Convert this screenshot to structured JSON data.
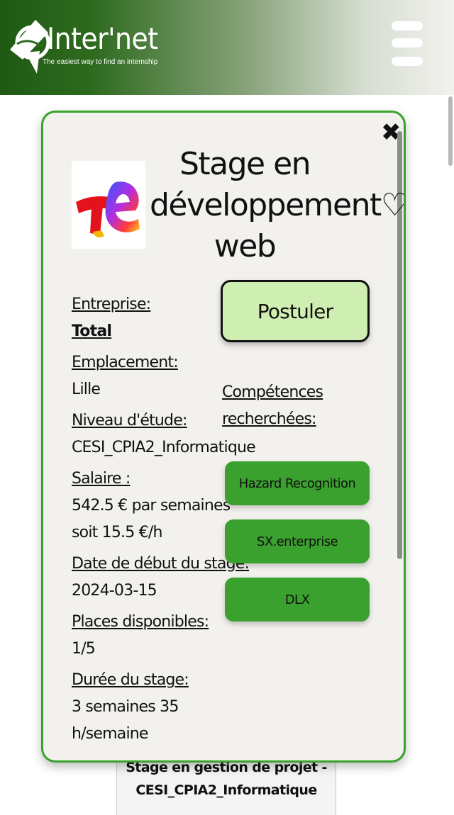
{
  "header": {
    "brand": "Inter'net",
    "tagline": "The easiest way to find an internship",
    "logo_icon": "globe-cap-icon",
    "menu_icon": "hamburger-menu-icon",
    "gradient_colors": [
      "#1f5a14",
      "#f2f2ee"
    ]
  },
  "background_card": {
    "line1": "Stage en gestion de projet -",
    "line2": "CESI_CPIA2_Informatique"
  },
  "modal": {
    "close_label": "✖",
    "title": "Stage en développement♡ web",
    "company_logo_icon": "total-logo-icon",
    "apply_label": "Postuler",
    "skills_label": "Compétences recherchées:",
    "skills": [
      "Hazard Recognition",
      "SX.enterprise",
      "DLX"
    ],
    "fields": {
      "company_label": "Entreprise:",
      "company_value": "Total",
      "location_label": "Emplacement:",
      "location_value": "Lille",
      "level_label": "Niveau d'étude:",
      "level_value": "CESI_CPIA2_Informatique",
      "salary_label": "Salaire :",
      "salary_value": "542.5 € par semaines soit 15.5 €/h",
      "start_label": "Date de début du stage:",
      "start_value": "2024-03-15",
      "places_label": "Places disponibles:",
      "places_value": "1/5",
      "duration_label": "Durée du stage:",
      "duration_value": "3 semaines 35 h/semaine"
    },
    "accent_color": "#37a22c",
    "apply_color": "#cfeeb2"
  }
}
